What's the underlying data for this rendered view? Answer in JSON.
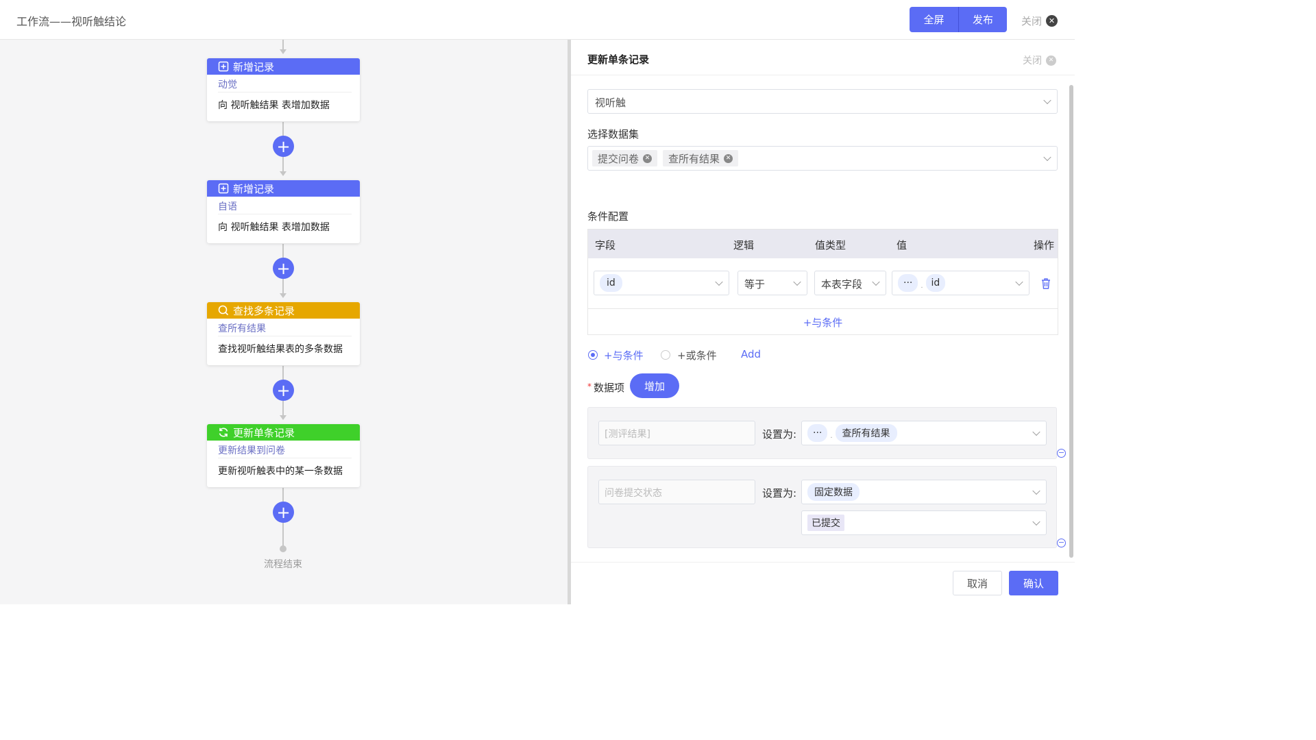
{
  "header": {
    "title": "工作流——视听触结论",
    "fullscreen_label": "全屏",
    "publish_label": "发布",
    "close_label": "关闭"
  },
  "flow": {
    "nodes": [
      {
        "type": "新增记录",
        "name": "动觉",
        "desc": "向 视听触结果 表增加数据",
        "color": "#5b6cf5",
        "icon": "plus-square-icon"
      },
      {
        "type": "新增记录",
        "name": "自语",
        "desc": "向 视听触结果 表增加数据",
        "color": "#5b6cf5",
        "icon": "plus-square-icon"
      },
      {
        "type": "查找多条记录",
        "name": "查所有结果",
        "desc": "查找视听触结果表的多条数据",
        "color": "#e6a700",
        "icon": "search-icon"
      },
      {
        "type": "更新单条记录",
        "name": "更新结果到问卷",
        "desc": "更新视听触表中的某一条数据",
        "color": "#3fd02a",
        "icon": "refresh-icon"
      }
    ],
    "end_label": "流程结束"
  },
  "panel": {
    "title": "更新单条记录",
    "close_label": "关闭",
    "table_select_value": "视听触",
    "dataset_label": "选择数据集",
    "dataset_tags": [
      "提交问卷",
      "查所有结果"
    ],
    "condition_label": "条件配置",
    "condition_table": {
      "headers": {
        "field": "字段",
        "logic": "逻辑",
        "value_type": "值类型",
        "value": "值",
        "action": "操作"
      },
      "row": {
        "field": "id",
        "logic": "等于",
        "value_type": "本表字段",
        "value_prefix": "···",
        "value": "id"
      },
      "add_and": "+与条件"
    },
    "radio_and": "+与条件",
    "radio_or": "+或条件",
    "add_link": "Add",
    "data_items_label": "数据项",
    "add_button": "增加",
    "data_items": [
      {
        "field_placeholder": "[测评结果]",
        "set_label": "设置为:",
        "value_prefix": "···",
        "value": "查所有结果"
      },
      {
        "field_placeholder": "问卷提交状态",
        "set_label": "设置为:",
        "value": "固定数据",
        "sub_value": "已提交"
      }
    ],
    "cancel_label": "取消",
    "confirm_label": "确认"
  }
}
